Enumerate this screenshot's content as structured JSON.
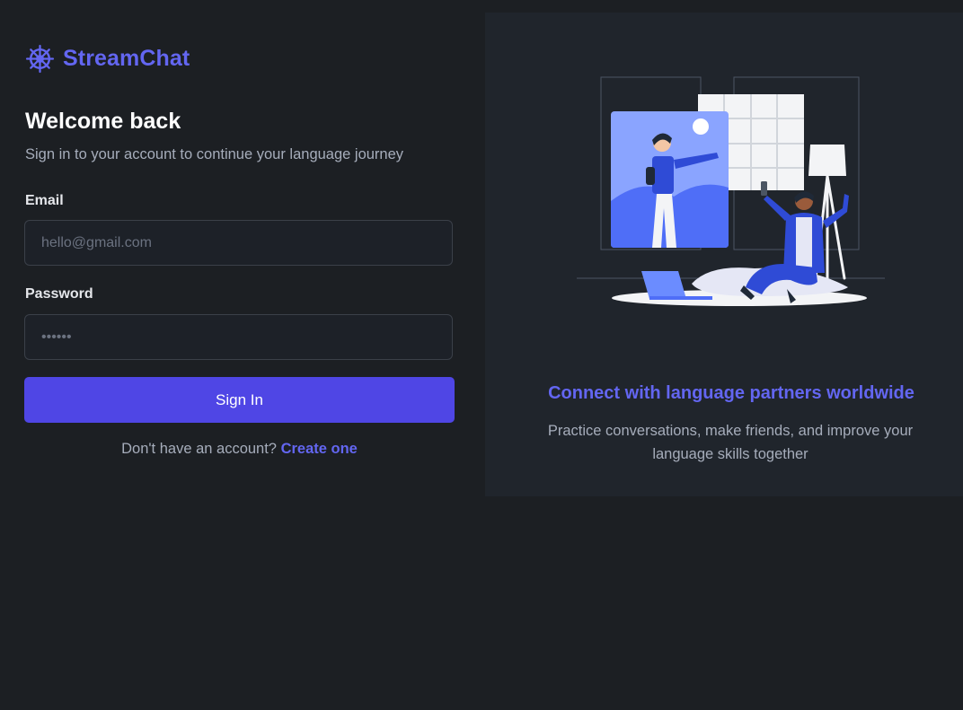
{
  "brand": {
    "name": "StreamChat",
    "icon": "ship-wheel-icon",
    "color": "#6366f1"
  },
  "login": {
    "title": "Welcome back",
    "subtitle": "Sign in to your account to continue your language journey",
    "email_label": "Email",
    "email_placeholder": "hello@gmail.com",
    "email_value": "",
    "password_label": "Password",
    "password_placeholder": "••••••",
    "password_value": "",
    "submit_label": "Sign In",
    "signup_prompt": "Don't have an account?",
    "signup_link": "Create one"
  },
  "promo": {
    "title": "Connect with language partners worldwide",
    "description": "Practice conversations, make friends, and improve your language skills together",
    "illustration": "video-call-illustration"
  },
  "colors": {
    "accent": "#6366f1",
    "button": "#4f46e5",
    "background": "#1c1f23",
    "panel": "#20252c"
  }
}
